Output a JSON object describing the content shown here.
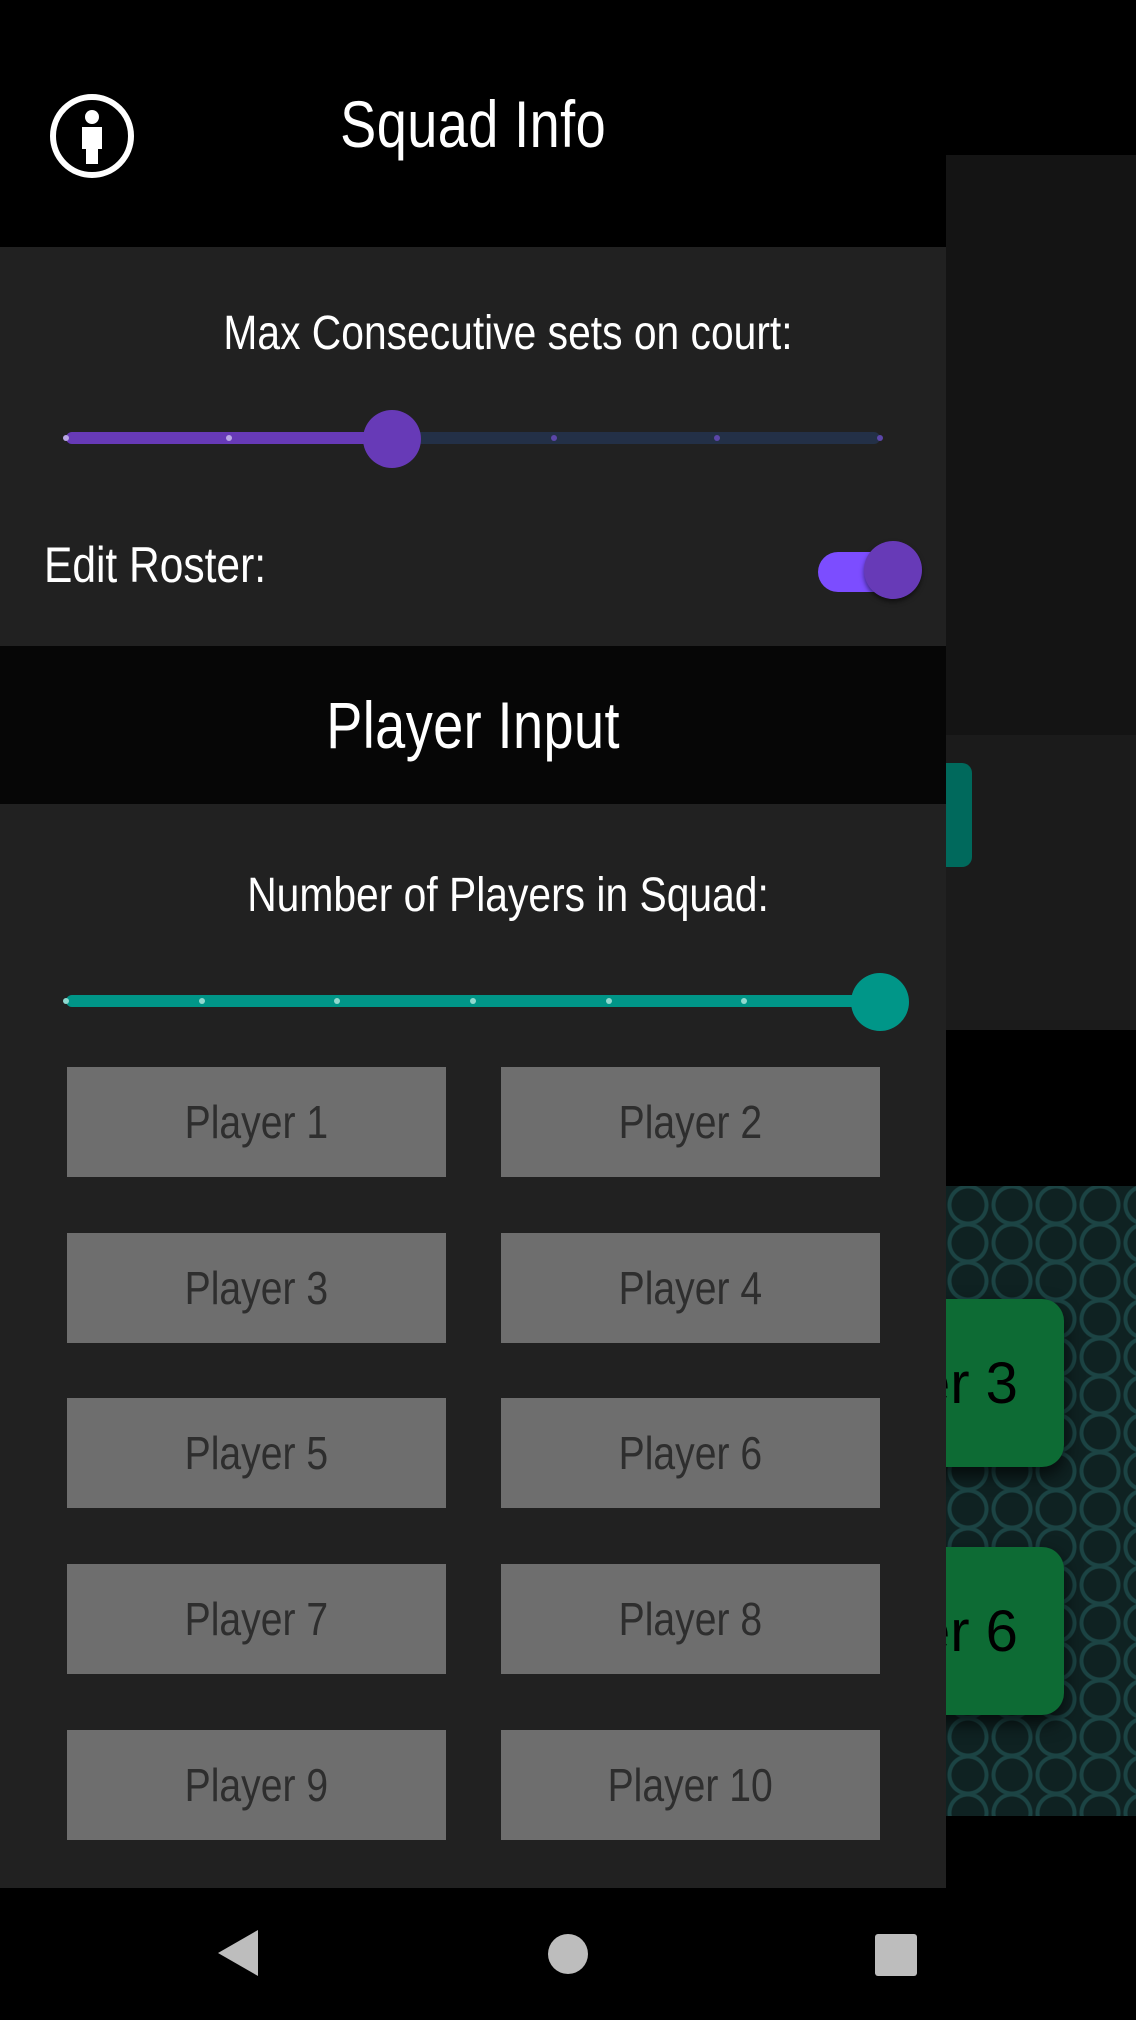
{
  "background": {
    "visible_card_1": "er 3",
    "visible_card_2": "er 6"
  },
  "squad_info": {
    "title": "Squad Info",
    "info_icon": "person-info-icon",
    "max_consecutive_label": "Max Consecutive sets on court:",
    "max_consecutive_slider": {
      "min": 0,
      "max": 5,
      "value": 2,
      "accent": "#673ab7",
      "inactive": "#233047"
    },
    "edit_roster_label": "Edit Roster:",
    "edit_roster_on": true
  },
  "player_input": {
    "title": "Player Input",
    "num_players_label": "Number of Players in Squad:",
    "num_players_slider": {
      "min": 0,
      "max": 6,
      "value": 6,
      "accent": "#009688"
    },
    "players": [
      "Player 1",
      "Player 2",
      "Player 3",
      "Player 4",
      "Player 5",
      "Player 6",
      "Player 7",
      "Player 8",
      "Player 9",
      "Player 10"
    ]
  },
  "nav": {
    "back_icon": "back-triangle-icon",
    "home_icon": "home-circle-icon",
    "recents_icon": "recents-square-icon"
  }
}
